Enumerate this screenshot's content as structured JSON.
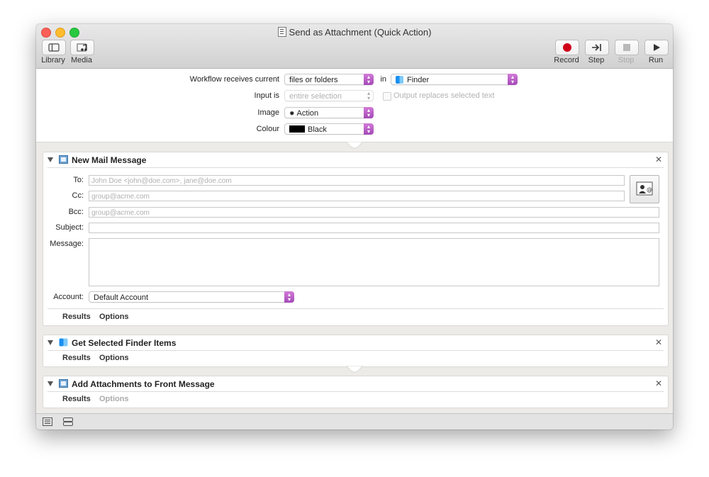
{
  "window": {
    "title": "Send as Attachment (Quick Action)"
  },
  "toolbar": {
    "library_label": "Library",
    "media_label": "Media",
    "record_label": "Record",
    "step_label": "Step",
    "stop_label": "Stop",
    "run_label": "Run"
  },
  "header": {
    "receives_label": "Workflow receives current",
    "receives_value": "files or folders",
    "in_label": "in",
    "in_value": "Finder",
    "input_is_label": "Input is",
    "input_is_value": "entire selection",
    "output_replaces_label": "Output replaces selected text",
    "image_label": "Image",
    "image_value": "Action",
    "colour_label": "Colour",
    "colour_value": "Black"
  },
  "actions": {
    "mail": {
      "title": "New Mail Message",
      "to_label": "To:",
      "to_placeholder": "John Doe <john@doe.com>, jane@doe.com",
      "cc_label": "Cc:",
      "cc_placeholder": "group@acme.com",
      "bcc_label": "Bcc:",
      "bcc_placeholder": "group@acme.com",
      "subject_label": "Subject:",
      "message_label": "Message:",
      "account_label": "Account:",
      "account_value": "Default Account",
      "results_label": "Results",
      "options_label": "Options"
    },
    "finder": {
      "title": "Get Selected Finder Items",
      "results_label": "Results",
      "options_label": "Options"
    },
    "attach": {
      "title": "Add Attachments to Front Message",
      "results_label": "Results",
      "options_label": "Options"
    }
  },
  "colors": {
    "record": "#d0021b",
    "popup_accent": "#b55fc4"
  }
}
